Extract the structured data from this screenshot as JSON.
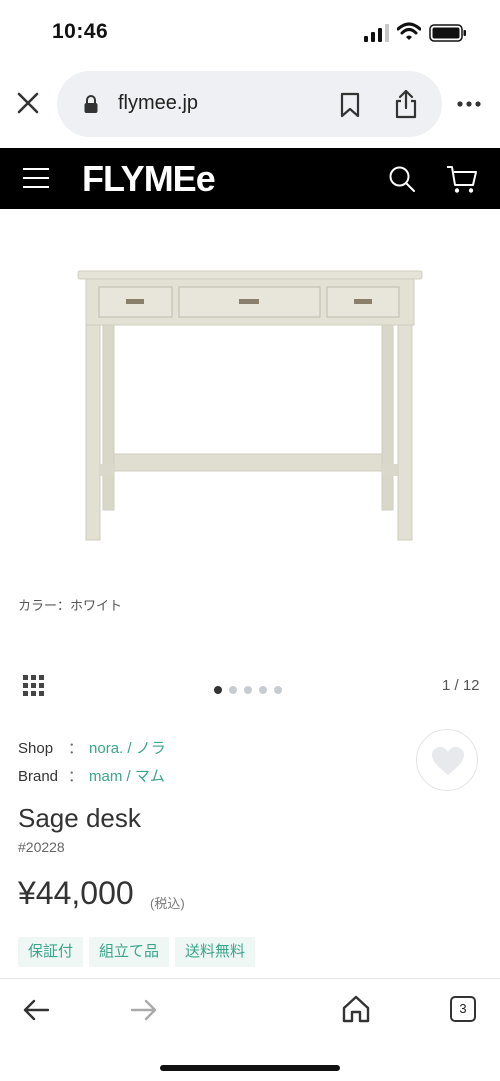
{
  "status_bar": {
    "time": "10:46"
  },
  "browser": {
    "url": "flymee.jp",
    "tab_count": "3"
  },
  "site": {
    "logo": "FLYMEe"
  },
  "product": {
    "image_caption": "カラー：ホワイト",
    "carousel": {
      "current": 1,
      "total": 12,
      "indicator": "1 / 12",
      "dots": 5
    },
    "shop_label": "Shop",
    "shop_sep": "：",
    "shop_value": "nora. / ノラ",
    "brand_label": "Brand",
    "brand_sep": "：",
    "brand_value": "mam / マム",
    "name": "Sage desk",
    "sku": "#20228",
    "price": "¥44,000",
    "tax_note": "(税込)",
    "tags": [
      "保証付",
      "組立て品",
      "送料無料"
    ]
  },
  "colors": {
    "accent": "#3aa58a",
    "header_bg": "#000000",
    "url_bar_bg": "#eef0f3",
    "tag_bg": "#eef7f4",
    "desk": "#e4e2d6"
  }
}
